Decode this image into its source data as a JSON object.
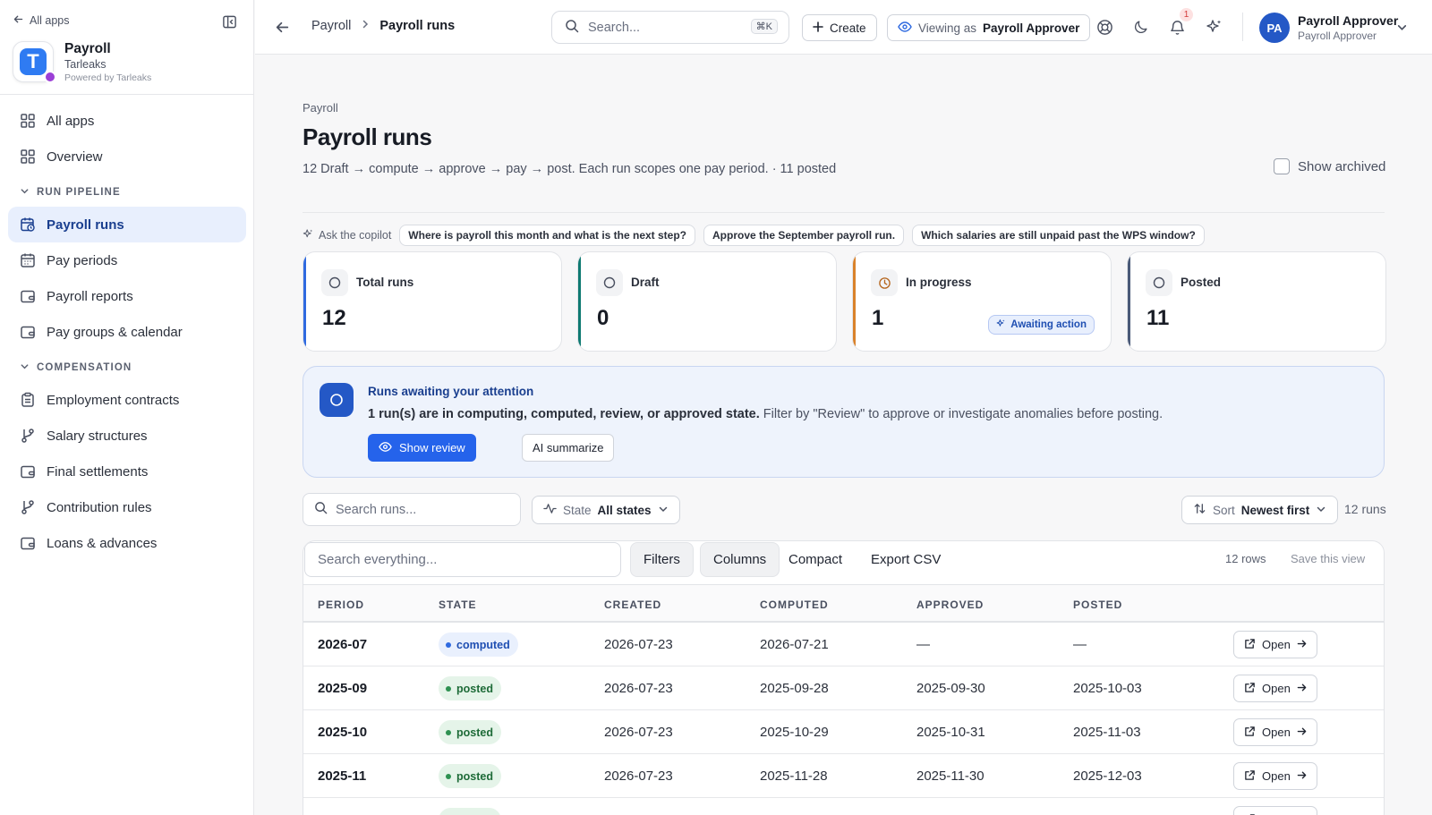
{
  "sidebar": {
    "all_apps_link": "All apps",
    "app": {
      "title": "Payroll",
      "org": "Tarleaks",
      "powered": "Powered by Tarleaks",
      "logo_letter": "T"
    },
    "items": [
      {
        "label": "All apps",
        "icon": "grid-icon"
      },
      {
        "label": "Overview",
        "icon": "grid-icon"
      }
    ],
    "sections": [
      {
        "label": "RUN PIPELINE",
        "items": [
          {
            "label": "Payroll runs",
            "active": true
          },
          {
            "label": "Pay periods"
          },
          {
            "label": "Payroll reports"
          },
          {
            "label": "Pay groups & calendar"
          }
        ]
      },
      {
        "label": "COMPENSATION",
        "items": [
          {
            "label": "Employment contracts"
          },
          {
            "label": "Salary structures"
          },
          {
            "label": "Final settlements"
          },
          {
            "label": "Contribution rules"
          },
          {
            "label": "Loans & advances"
          }
        ]
      }
    ]
  },
  "topbar": {
    "breadcrumb": [
      "Payroll",
      "Payroll runs"
    ],
    "search_placeholder": "Search...",
    "search_shortcut": "⌘K",
    "create_label": "Create",
    "viewing_prefix": "Viewing as",
    "viewing_role": "Payroll Approver",
    "notification_count": "1",
    "user": {
      "initials": "PA",
      "name": "Payroll Approver",
      "role": "Payroll Approver"
    }
  },
  "page": {
    "eyebrow": "Payroll",
    "title": "Payroll runs",
    "subtitle": "12 Draft → compute → approve → pay → post. Each run scopes one pay period. · 11 posted",
    "show_archived": "Show archived"
  },
  "copilot": {
    "label": "Ask the copilot",
    "suggestions": [
      "Where is payroll this month and what is the next step?",
      "Approve the September payroll run.",
      "Which salaries are still unpaid past the WPS window?"
    ]
  },
  "stats": [
    {
      "label": "Total runs",
      "value": "12",
      "accent": "#2f6ae0"
    },
    {
      "label": "Draft",
      "value": "0",
      "accent": "#0f7a72"
    },
    {
      "label": "In progress",
      "value": "1",
      "accent": "#d9822b",
      "pill": "Awaiting action"
    },
    {
      "label": "Posted",
      "value": "11",
      "accent": "#4a5a78"
    }
  ],
  "attention": {
    "title": "Runs awaiting your attention",
    "bold_text": "1 run(s) are in computing, computed, review, or approved state.",
    "text": " Filter by \"Review\" to approve or investigate anomalies before posting.",
    "primary_button": "Show review",
    "secondary_button": "AI summarize"
  },
  "filters": {
    "search_placeholder": "Search runs...",
    "state_label": "State",
    "state_value": "All states",
    "sort_label": "Sort",
    "sort_value": "Newest first",
    "count": "12 runs"
  },
  "table": {
    "search_placeholder": "Search everything...",
    "toolbar": {
      "filters": "Filters",
      "columns": "Columns",
      "compact": "Compact",
      "export": "Export CSV",
      "rows_count": "12 rows",
      "save_view": "Save this view"
    },
    "headers": [
      "PERIOD",
      "STATE",
      "CREATED",
      "COMPUTED",
      "APPROVED",
      "POSTED"
    ],
    "open_label": "Open",
    "rows": [
      {
        "period": "2026-07",
        "state": "computed",
        "created": "2026-07-23",
        "computed": "2026-07-21",
        "approved": "—",
        "posted": "—"
      },
      {
        "period": "2025-09",
        "state": "posted",
        "created": "2026-07-23",
        "computed": "2025-09-28",
        "approved": "2025-09-30",
        "posted": "2025-10-03"
      },
      {
        "period": "2025-10",
        "state": "posted",
        "created": "2026-07-23",
        "computed": "2025-10-29",
        "approved": "2025-10-31",
        "posted": "2025-11-03"
      },
      {
        "period": "2025-11",
        "state": "posted",
        "created": "2026-07-23",
        "computed": "2025-11-28",
        "approved": "2025-11-30",
        "posted": "2025-12-03"
      },
      {
        "period": "",
        "state": "posted",
        "created": "",
        "computed": "",
        "approved": "",
        "posted": ""
      }
    ]
  }
}
